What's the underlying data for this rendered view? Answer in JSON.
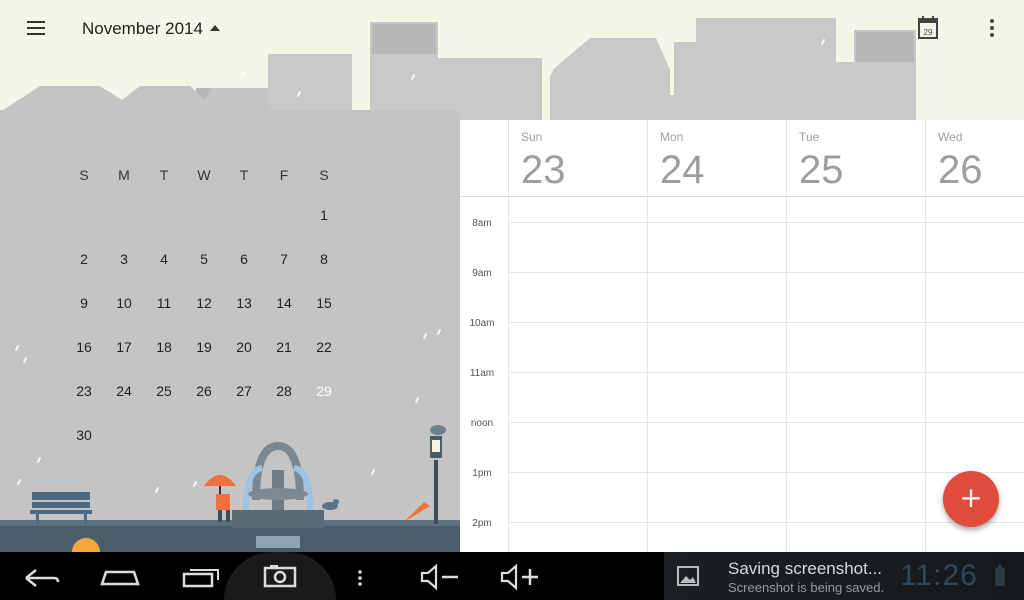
{
  "header": {
    "month_label": "November 2014",
    "today_icon_day": "29"
  },
  "icons": {
    "menu": "hamburger-menu-icon",
    "caret": "caret-up-icon",
    "today": "calendar-today-icon",
    "overflow": "more-vert-icon",
    "fab": "plus-icon"
  },
  "mini_month": {
    "weekdays": [
      "S",
      "M",
      "T",
      "W",
      "T",
      "F",
      "S"
    ],
    "weeks": [
      [
        "",
        "",
        "",
        "",
        "",
        "",
        "1"
      ],
      [
        "2",
        "3",
        "4",
        "5",
        "6",
        "7",
        "8"
      ],
      [
        "9",
        "10",
        "11",
        "12",
        "13",
        "14",
        "15"
      ],
      [
        "16",
        "17",
        "18",
        "19",
        "20",
        "21",
        "22"
      ],
      [
        "23",
        "24",
        "25",
        "26",
        "27",
        "28",
        "29"
      ],
      [
        "30",
        "",
        "",
        "",
        "",
        "",
        ""
      ]
    ],
    "selected_day": "29"
  },
  "week": {
    "days": [
      {
        "name": "Sun",
        "number": "23"
      },
      {
        "name": "Mon",
        "number": "24"
      },
      {
        "name": "Tue",
        "number": "25"
      },
      {
        "name": "Wed",
        "number": "26"
      }
    ],
    "hours": [
      "8am",
      "9am",
      "10am",
      "11am",
      "noon",
      "1pm",
      "2pm"
    ]
  },
  "fab": {
    "label": "+"
  },
  "colors": {
    "accent_blue": "#4285f4",
    "fab_red": "#e04b3b",
    "sky": "#f3f7ea",
    "city_gray": "#c4c4c4"
  },
  "notification": {
    "title": "Saving screenshot...",
    "subtitle": "Screenshot is being saved.",
    "clock": "11:26"
  },
  "navbar": {
    "buttons": [
      "back-icon",
      "home-icon",
      "recent-apps-icon",
      "screenshot-icon",
      "more-icon",
      "volume-down-icon",
      "volume-up-icon"
    ]
  }
}
